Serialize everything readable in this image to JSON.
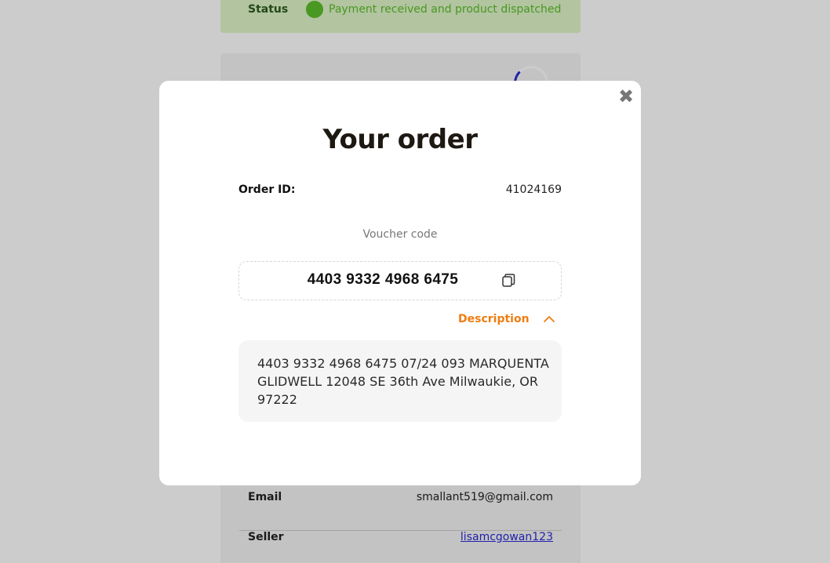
{
  "background": {
    "status": {
      "label": "Status",
      "text": "Payment received and product dispatched"
    },
    "details": [
      {
        "label": "Email",
        "value": "smallant519@gmail.com"
      },
      {
        "label": "Seller",
        "value": "lisamcgowan123"
      }
    ]
  },
  "modal": {
    "title": "Your order",
    "close_icon": "close-icon",
    "order_id_label": "Order ID:",
    "order_id_value": "41024169",
    "voucher_label": "Voucher code",
    "voucher_code": "4403 9332 4968 6475",
    "copy_icon": "copy-icon",
    "description_label": "Description",
    "description_toggle_icon": "chevron-up-icon",
    "description_text": "4403 9332 4968 6475 07/24 093 MARQUENTA GLIDWELL 12048 SE 36th Ave Milwaukie, OR 97222"
  },
  "colors": {
    "accent": "#ee7d10",
    "status_green": "#5bbf2a",
    "link": "#2a2ad6"
  }
}
